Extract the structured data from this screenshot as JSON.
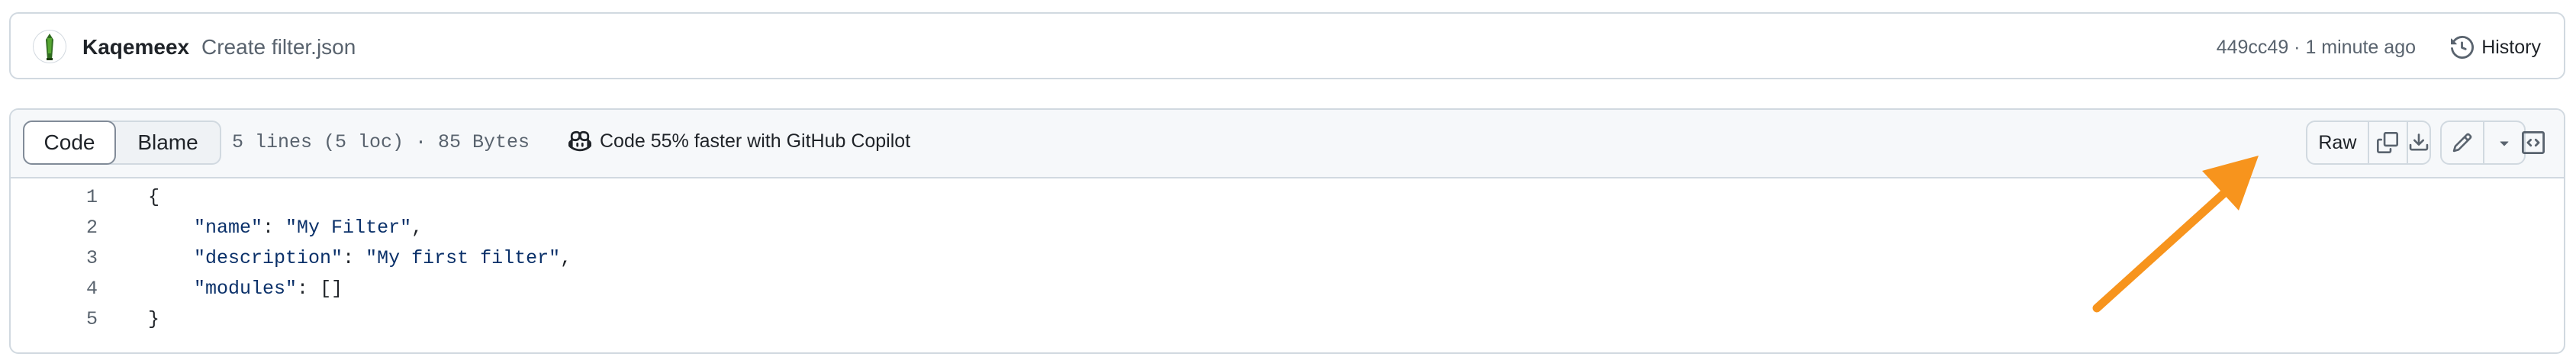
{
  "commit": {
    "author": "Kaqemeex",
    "message": "Create filter.json",
    "sha_time": "449cc49 · 1 minute ago",
    "history_label": "History"
  },
  "file": {
    "tab_code": "Code",
    "tab_blame": "Blame",
    "info": "5 lines (5 loc) · 85 Bytes",
    "copilot_text": "Code 55% faster with GitHub Copilot",
    "raw_label": "Raw"
  },
  "code_lines": [
    {
      "num": "1",
      "indent": "",
      "key": "",
      "sep": "",
      "value": "{"
    },
    {
      "num": "2",
      "indent": "    ",
      "key": "\"name\"",
      "sep": ": ",
      "value": "\"My Filter\","
    },
    {
      "num": "3",
      "indent": "    ",
      "key": "\"description\"",
      "sep": ": ",
      "value": "\"My first filter\","
    },
    {
      "num": "4",
      "indent": "    ",
      "key": "\"modules\"",
      "sep": ": ",
      "value": "[]"
    },
    {
      "num": "5",
      "indent": "",
      "key": "",
      "sep": "",
      "value": "}"
    }
  ],
  "icons": {
    "history": "history-icon",
    "copilot": "copilot-icon",
    "copy": "copy-icon",
    "download": "download-icon",
    "edit": "pencil-icon",
    "dropdown": "triangle-down-icon",
    "symbols": "code-square-icon"
  },
  "colors": {
    "arrow": "#f7941d",
    "border": "#d1d9e0",
    "muted_text": "#59636e",
    "code_string": "#0a3069"
  }
}
